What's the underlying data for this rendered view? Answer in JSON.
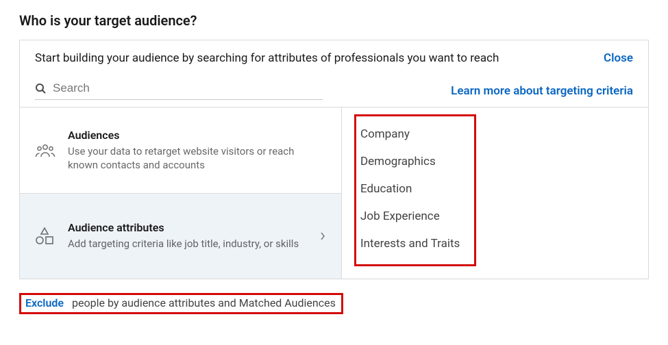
{
  "pageTitle": "Who is your target audience?",
  "panel": {
    "topText": "Start building your audience by searching for attributes of professionals you want to reach",
    "closeLabel": "Close",
    "search": {
      "placeholder": "Search"
    },
    "learnMoreLabel": "Learn more about targeting criteria",
    "options": {
      "audiences": {
        "title": "Audiences",
        "desc": "Use your data to retarget website visitors or reach known contacts and accounts"
      },
      "attributes": {
        "title": "Audience attributes",
        "desc": "Add targeting criteria like job title, industry, or skills"
      }
    },
    "attributeList": {
      "a": "Company",
      "b": "Demographics",
      "c": "Education",
      "d": "Job Experience",
      "e": "Interests and Traits"
    }
  },
  "footer": {
    "excludeLabel": "Exclude",
    "excludeText": "people by audience attributes and Matched Audiences"
  }
}
